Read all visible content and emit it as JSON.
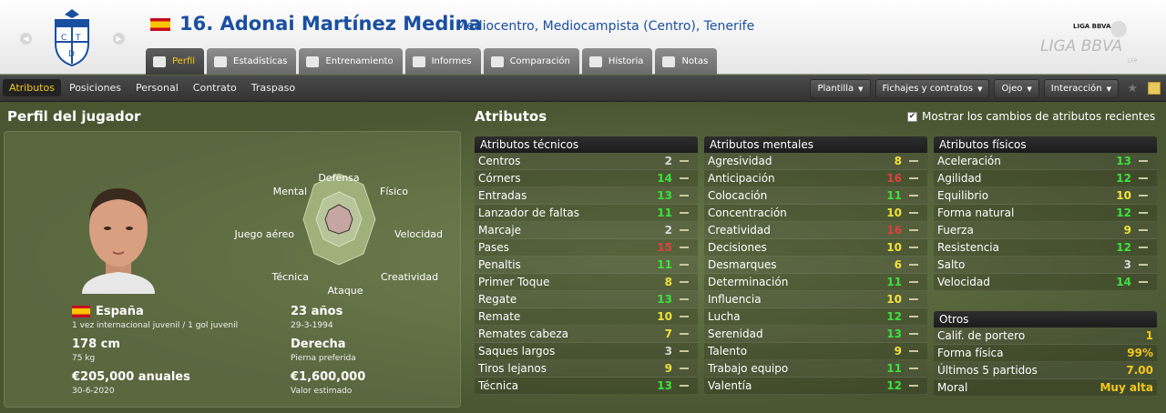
{
  "header": {
    "number": "16.",
    "name": "Adonai Martínez Medina",
    "description": "Mediocentro, Mediocampista (Centro), Tenerife",
    "crest_letters": [
      "C",
      "D",
      "T"
    ],
    "league_logo_small": "LIGA BBVA",
    "league_logo_big": "LIGA BBVA",
    "league_lfp": "LFP"
  },
  "tabs": [
    {
      "label": "Perfil",
      "icon": "profile-icon"
    },
    {
      "label": "Estadísticas",
      "icon": "stats-icon"
    },
    {
      "label": "Entrenamiento",
      "icon": "training-icon"
    },
    {
      "label": "Informes",
      "icon": "report-icon"
    },
    {
      "label": "Comparación",
      "icon": "compare-icon"
    },
    {
      "label": "Historia",
      "icon": "history-icon"
    },
    {
      "label": "Notas",
      "icon": "notes-icon"
    }
  ],
  "subtabs": [
    "Atributos",
    "Posiciones",
    "Personal",
    "Contrato",
    "Traspaso"
  ],
  "menus": [
    "Plantilla",
    "Fichajes y contratos",
    "Ojeo",
    "Interacción"
  ],
  "profile": {
    "title": "Perfil del jugador",
    "radar_labels": {
      "top": "Defensa",
      "top_right": "Físico",
      "right": "Velocidad",
      "bottom_right": "Creatividad",
      "bottom": "Ataque",
      "bottom_left": "Técnica",
      "left": "Juego aéreo",
      "top_left": "Mental"
    },
    "nation": "España",
    "caps": "1 vez internacional juvenil / 1 gol juvenil",
    "age": "23 años",
    "birthdate": "29-3-1994",
    "height": "178 cm",
    "weight": "75 kg",
    "foot": "Derecha",
    "foot_label": "Pierna preferida",
    "wage": "€205,000 anuales",
    "contract_end": "30-6-2020",
    "value": "€1,600,000",
    "value_label": "Valor estimado"
  },
  "attributes": {
    "title": "Atributos",
    "show_changes": "Mostrar los cambios de atributos recientes",
    "technical": {
      "title": "Atributos técnicos",
      "rows": [
        [
          "Centros",
          "2"
        ],
        [
          "Córners",
          "14"
        ],
        [
          "Entradas",
          "13"
        ],
        [
          "Lanzador de faltas",
          "11"
        ],
        [
          "Marcaje",
          "2"
        ],
        [
          "Pases",
          "15"
        ],
        [
          "Penaltis",
          "11"
        ],
        [
          "Primer Toque",
          "8"
        ],
        [
          "Regate",
          "13"
        ],
        [
          "Remate",
          "10"
        ],
        [
          "Remates cabeza",
          "7"
        ],
        [
          "Saques largos",
          "3"
        ],
        [
          "Tiros lejanos",
          "9"
        ],
        [
          "Técnica",
          "13"
        ]
      ]
    },
    "mental": {
      "title": "Atributos mentales",
      "rows": [
        [
          "Agresividad",
          "8"
        ],
        [
          "Anticipación",
          "16"
        ],
        [
          "Colocación",
          "11"
        ],
        [
          "Concentración",
          "10"
        ],
        [
          "Creatividad",
          "16"
        ],
        [
          "Decisiones",
          "10"
        ],
        [
          "Desmarques",
          "6"
        ],
        [
          "Determinación",
          "11"
        ],
        [
          "Influencia",
          "10"
        ],
        [
          "Lucha",
          "12"
        ],
        [
          "Serenidad",
          "13"
        ],
        [
          "Talento",
          "9"
        ],
        [
          "Trabajo equipo",
          "11"
        ],
        [
          "Valentía",
          "12"
        ]
      ]
    },
    "physical": {
      "title": "Atributos físicos",
      "rows": [
        [
          "Aceleración",
          "13"
        ],
        [
          "Agilidad",
          "12"
        ],
        [
          "Equilibrio",
          "10"
        ],
        [
          "Forma natural",
          "12"
        ],
        [
          "Fuerza",
          "9"
        ],
        [
          "Resistencia",
          "12"
        ],
        [
          "Salto",
          "3"
        ],
        [
          "Velocidad",
          "14"
        ]
      ]
    },
    "other": {
      "title": "Otros",
      "rows": [
        [
          "Calif. de portero",
          "1"
        ],
        [
          "Forma física",
          "99%"
        ],
        [
          "Últimos 5 partidos",
          "7.00"
        ],
        [
          "Moral",
          "Muy alta"
        ]
      ]
    }
  },
  "colors": {
    "accent": "#f3c81a",
    "green": "#3ee03e",
    "yellow": "#f2e23a",
    "red": "#e04040",
    "grey": "#d8d8d8"
  }
}
